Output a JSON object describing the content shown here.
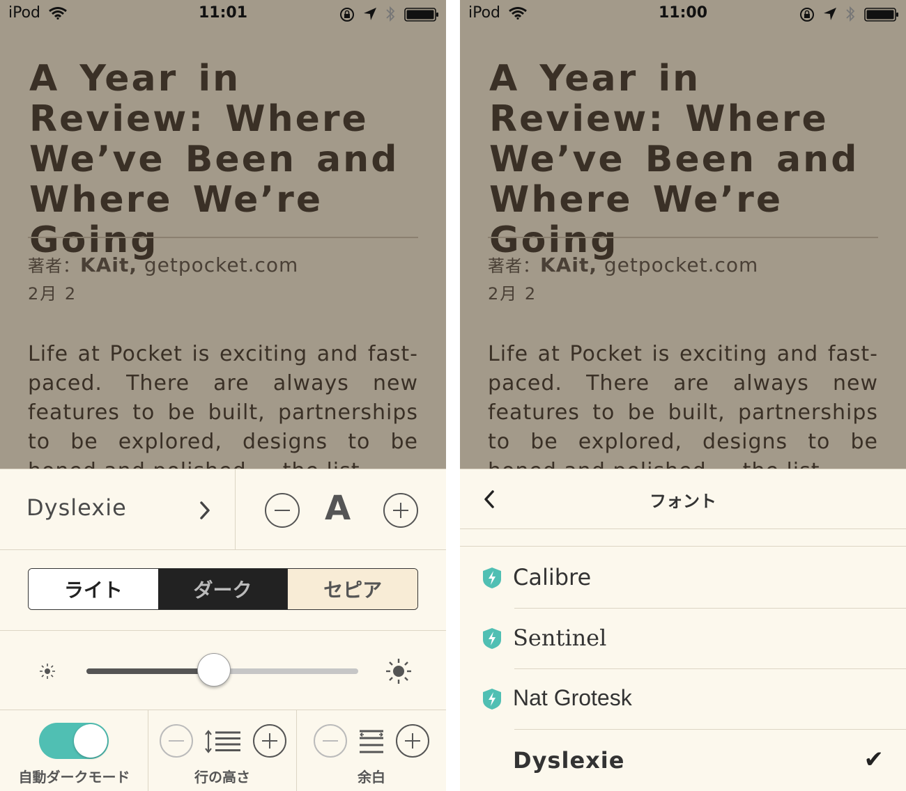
{
  "status_left": {
    "carrier": "iPod",
    "time": "11:01"
  },
  "status_right": {
    "carrier": "iPod",
    "time": "11:00"
  },
  "article": {
    "title": "A Year in Review: Where We’ve Been and Where We’re Going",
    "byline_prefix": "著者：",
    "author": "KAit,",
    "source": "getpocket.com",
    "date": "2月 2",
    "body": "Life at Pocket is exciting and fast-paced. There are always new features to be built, partnerships to be explored, designs to be honed and polished — the list"
  },
  "settings": {
    "font_name": "Dyslexie",
    "font_size_glyph": "A",
    "themes": {
      "light": "ライト",
      "dark": "ダーク",
      "sepia": "セピア"
    },
    "selected_theme": "sepia",
    "brightness": 0.47,
    "auto_dark_label": "自動ダークモード",
    "auto_dark_on": true,
    "line_height_label": "行の高さ",
    "margin_label": "余白"
  },
  "font_picker": {
    "title": "フォント",
    "fonts": [
      {
        "name": "Calibre",
        "premium": true,
        "selected": false
      },
      {
        "name": "Sentinel",
        "premium": true,
        "selected": false
      },
      {
        "name": "Nat Grotesk",
        "premium": true,
        "selected": false
      },
      {
        "name": "Dyslexie",
        "premium": false,
        "selected": true
      }
    ],
    "check_mark": "✔",
    "badge_color": "#50bfb3"
  },
  "colors": {
    "accent": "#50bfb3",
    "sepia_bg": "#fcf8ed",
    "dim_overlay": "#a39a8a",
    "text_dark": "#3a3026"
  }
}
